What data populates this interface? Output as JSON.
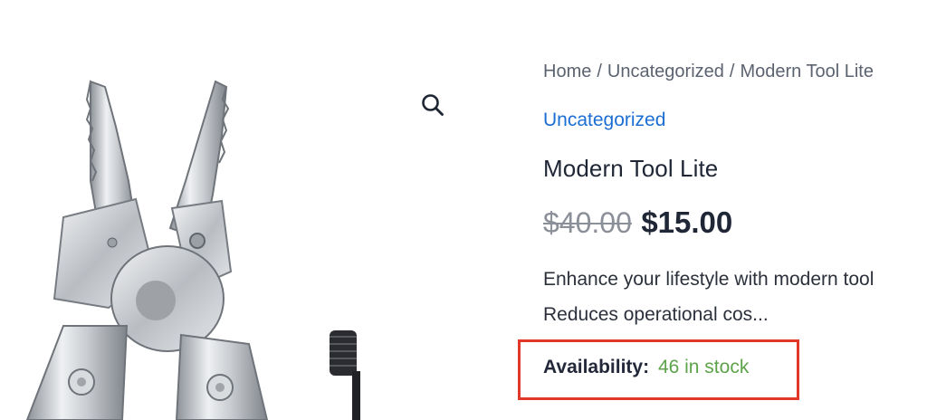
{
  "gallery": {
    "image_alt": "Modern Tool Lite multi-tool pliers",
    "zoom_icon": "search-icon"
  },
  "breadcrumb": {
    "items": [
      "Home",
      "Uncategorized",
      "Modern Tool Lite"
    ],
    "separator": "/"
  },
  "product": {
    "category": "Uncategorized",
    "title": "Modern Tool Lite",
    "price_old": "$40.00",
    "price_new": "$15.00",
    "description_line1": "Enhance your lifestyle with modern tool",
    "description_line2": "Reduces operational cos...",
    "availability_label": "Availability:",
    "availability_value": "46 in stock"
  },
  "colors": {
    "link": "#1c6ed3",
    "in_stock": "#5ca34a",
    "highlight_border": "#e2382a"
  }
}
